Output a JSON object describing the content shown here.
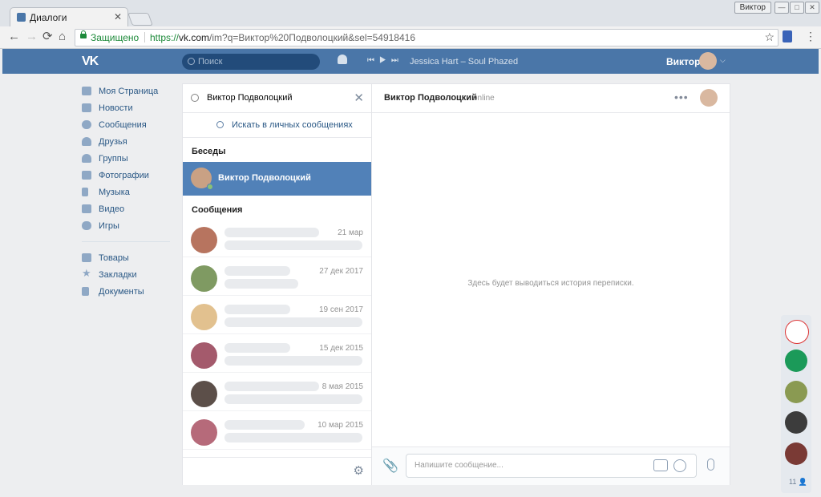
{
  "browser": {
    "tab_title": "Диалоги",
    "tab_close": "✕",
    "user_badge": "Виктор",
    "win_min": "—",
    "win_max": "□",
    "win_close": "✕",
    "back_icon": "←",
    "forward_icon": "→",
    "reload_icon": "⟳",
    "home_icon": "⌂",
    "secure_label": "Защищено",
    "url_scheme": "https://",
    "url_host": "vk.com",
    "url_rest": "/im?q=Виктор%20Подволоцкий&sel=54918416",
    "star_icon": "☆",
    "menu_icon": "⋮"
  },
  "header": {
    "logo": "VK",
    "search_placeholder": "Поиск",
    "player_controls": "⏮▶⏭",
    "track": "Jessica Hart – Soul Phazed",
    "user_name": "Виктор",
    "chevron": "⌵"
  },
  "nav": {
    "items": [
      {
        "label": "Моя Страница",
        "icon": "home-icon"
      },
      {
        "label": "Новости",
        "icon": "news-icon"
      },
      {
        "label": "Сообщения",
        "icon": "messages-icon"
      },
      {
        "label": "Друзья",
        "icon": "friends-icon"
      },
      {
        "label": "Группы",
        "icon": "groups-icon"
      },
      {
        "label": "Фотографии",
        "icon": "camera-icon"
      },
      {
        "label": "Музыка",
        "icon": "music-icon"
      },
      {
        "label": "Видео",
        "icon": "video-icon"
      },
      {
        "label": "Игры",
        "icon": "games-icon"
      }
    ],
    "items2": [
      {
        "label": "Товары",
        "icon": "bag-icon"
      },
      {
        "label": "Закладки",
        "icon": "star-icon"
      },
      {
        "label": "Документы",
        "icon": "document-icon"
      }
    ]
  },
  "dialogs": {
    "query": "Виктор Подволоцкий",
    "clear_icon": "✕",
    "search_in_messages": "Искать в личных сообщениях",
    "conversations_title": "Беседы",
    "conversation_name": "Виктор Подволоцкий",
    "messages_title": "Сообщения",
    "messages": [
      {
        "date": "21 мар"
      },
      {
        "date": "27 дек 2017"
      },
      {
        "date": "19 сен 2017"
      },
      {
        "date": "15 дек 2015"
      },
      {
        "date": "8 мая 2015"
      },
      {
        "date": "10 мар 2015"
      }
    ],
    "settings_icon": "⚙"
  },
  "chat": {
    "name": "Виктор Подволоцкий",
    "status": "online",
    "more": "•••",
    "empty_text": "Здесь будет выводиться история переписки.",
    "attach_icon": "📎",
    "input_placeholder": "Напишите сообщение..."
  },
  "strip": {
    "count": "11 👤"
  },
  "colors": {
    "brand": "#4a76a8",
    "selected_row": "#5181b8",
    "link": "#2a5885"
  }
}
